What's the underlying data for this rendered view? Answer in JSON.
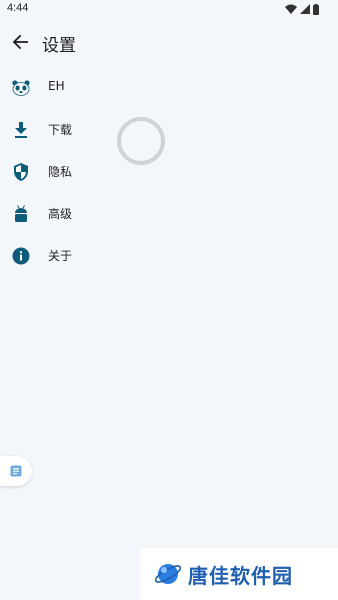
{
  "status_bar": {
    "time": "4:44"
  },
  "app_bar": {
    "title": "设置"
  },
  "menu": {
    "items": [
      {
        "label": "EH",
        "icon": "panda-icon"
      },
      {
        "label": "下载",
        "icon": "download-icon"
      },
      {
        "label": "隐私",
        "icon": "shield-icon"
      },
      {
        "label": "高级",
        "icon": "android-icon"
      },
      {
        "label": "关于",
        "icon": "info-icon"
      }
    ]
  },
  "watermark": {
    "text": "唐佳软件园"
  },
  "colors": {
    "accent": "#0f5c7a",
    "background": "#f3f7fb",
    "spinner": "#cfd3d8",
    "watermark": "#1f5fb0"
  }
}
